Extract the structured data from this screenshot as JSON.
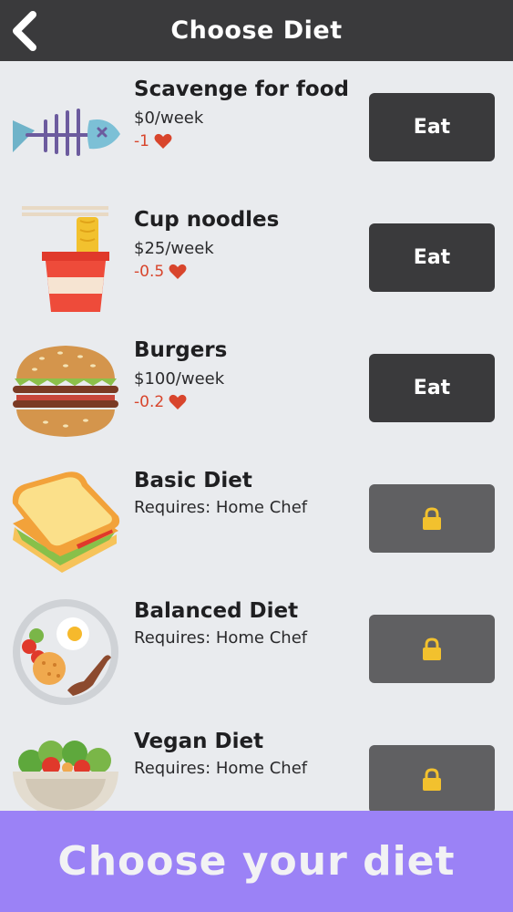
{
  "header": {
    "title": "Choose Diet"
  },
  "diets": [
    {
      "name": "Scavenge for food",
      "price": "$0/week",
      "health": "-1",
      "button": "Eat",
      "icon": "fish-bone-icon",
      "locked": false
    },
    {
      "name": "Cup noodles",
      "price": "$25/week",
      "health": "-0.5",
      "button": "Eat",
      "icon": "cup-noodles-icon",
      "locked": false
    },
    {
      "name": "Burgers",
      "price": "$100/week",
      "health": "-0.2",
      "button": "Eat",
      "icon": "burger-icon",
      "locked": false
    },
    {
      "name": "Basic Diet",
      "requires": "Requires: Home Chef",
      "icon": "sandwich-icon",
      "locked": true
    },
    {
      "name": "Balanced Diet",
      "requires": "Requires: Home Chef",
      "icon": "balanced-plate-icon",
      "locked": true
    },
    {
      "name": "Vegan Diet",
      "requires": "Requires: Home Chef",
      "icon": "salad-bowl-icon",
      "locked": true
    }
  ],
  "footer": {
    "text": "Choose your diet"
  },
  "colors": {
    "header": "#3a3a3c",
    "button": "#3a3a3c",
    "locked_button": "#606062",
    "health": "#d8452c",
    "footer": "#9b82f6",
    "lock": "#f2c12e"
  }
}
